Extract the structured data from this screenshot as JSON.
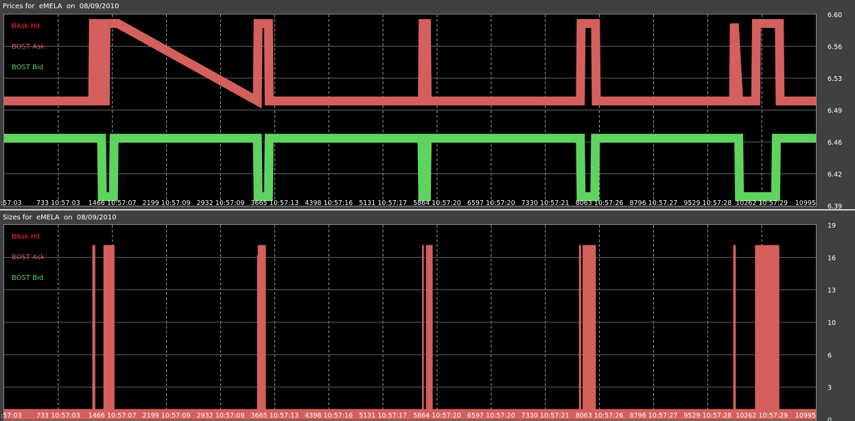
{
  "colors": {
    "bask_hit": "#ff2a2a",
    "bost_ask": "#d4605e",
    "bost_bid": "#5fd35f",
    "grid": "#666666",
    "background": "#000000"
  },
  "chart_data": [
    {
      "type": "line",
      "title": "Prices for  eMELA  on  08/09/2010",
      "x_ticks": [
        ":57:03",
        "733 10:57:03",
        "1466 10:57:07",
        "2199 10:57:09",
        "2932 10:57:09",
        "3665 10:57:13",
        "4398 10:57:16",
        "5131 10:57:17",
        "5864 10:57:20",
        "6597 10:57:20",
        "7330 10:57:21",
        "8063 10:57:26",
        "8796 10:57:27",
        "9529 10:57:28",
        "10262 10:57:29",
        "10995"
      ],
      "xlim": [
        0,
        10995
      ],
      "y_ticks": [
        "6.60",
        "6.56",
        "6.53",
        "6.49",
        "6.46",
        "6.42",
        "6.39"
      ],
      "ylim": [
        6.39,
        6.6
      ],
      "grid": true,
      "legend_placement": "top-left",
      "legend": [
        "BAsk Hit",
        "BOST Ask",
        "BOST Bid"
      ],
      "series": [
        {
          "name": "BOST Ask",
          "x": [
            0,
            1200,
            1210,
            1300,
            1310,
            1370,
            1380,
            1540,
            3430,
            3440,
            3580,
            3590,
            5665,
            5675,
            5720,
            5730,
            5830,
            7805,
            7815,
            8010,
            8020,
            9880,
            9890,
            9950,
            10180,
            10190,
            10500,
            10510,
            10995
          ],
          "y": [
            6.505,
            6.505,
            6.59,
            6.59,
            6.505,
            6.505,
            6.59,
            6.59,
            6.505,
            6.59,
            6.59,
            6.505,
            6.505,
            6.59,
            6.59,
            6.505,
            6.505,
            6.505,
            6.59,
            6.59,
            6.505,
            6.505,
            6.59,
            6.505,
            6.505,
            6.59,
            6.59,
            6.505,
            6.505
          ]
        },
        {
          "name": "BOST Bid",
          "x": [
            0,
            1320,
            1330,
            1380,
            1480,
            1490,
            3430,
            3440,
            3580,
            3590,
            5660,
            5670,
            5720,
            5730,
            7805,
            7815,
            8000,
            8010,
            9880,
            9950,
            9960,
            10200,
            10450,
            10460,
            10995
          ],
          "y": [
            6.464,
            6.464,
            6.4,
            6.4,
            6.4,
            6.464,
            6.464,
            6.4,
            6.4,
            6.464,
            6.464,
            6.4,
            6.4,
            6.464,
            6.464,
            6.4,
            6.4,
            6.464,
            6.464,
            6.464,
            6.4,
            6.4,
            6.4,
            6.464,
            6.464
          ]
        }
      ]
    },
    {
      "type": "area",
      "title": "Sizes for  eMELA  on  08/09/2010",
      "x_ticks": [
        ":57:03",
        "733 10:57:03",
        "1466 10:57:07",
        "2199 10:57:09",
        "2932 10:57:09",
        "3665 10:57:13",
        "4398 10:57:16",
        "5131 10:57:17",
        "5864 10:57:20",
        "6597 10:57:20",
        "7330 10:57:21",
        "8063 10:57:26",
        "8796 10:57:27",
        "9529 10:57:28",
        "10262 10:57:29",
        "10995"
      ],
      "xlim": [
        0,
        10995
      ],
      "y_ticks": [
        "19",
        "16",
        "13",
        "10",
        "6",
        "3",
        "0"
      ],
      "ylim": [
        0,
        19
      ],
      "grid": true,
      "legend_placement": "top-left",
      "legend": [
        "BAsk Hit",
        "BOST Ask",
        "BOST Bid"
      ],
      "series": [
        {
          "name": "BOST Ask",
          "x": [
            0,
            1200,
            1200,
            1230,
            1230,
            1350,
            1350,
            1490,
            1490,
            3430,
            3430,
            3440,
            3440,
            3540,
            3540,
            3575,
            3575,
            5665,
            5665,
            5680,
            5680,
            5720,
            5720,
            5800,
            5800,
            7790,
            7790,
            7810,
            7810,
            7840,
            7840,
            8010,
            8010,
            9880,
            9880,
            9905,
            9905,
            10175,
            10175,
            10495,
            10495,
            10995
          ],
          "y": [
            1,
            1,
            17,
            17,
            1,
            1,
            17,
            17,
            1,
            1,
            16,
            16,
            17,
            17,
            1,
            1,
            1,
            1,
            17,
            17,
            1,
            1,
            17,
            17,
            1,
            1,
            17,
            17,
            1,
            1,
            17,
            17,
            1,
            1,
            17,
            17,
            1,
            1,
            17,
            17,
            1,
            1
          ]
        }
      ]
    }
  ]
}
